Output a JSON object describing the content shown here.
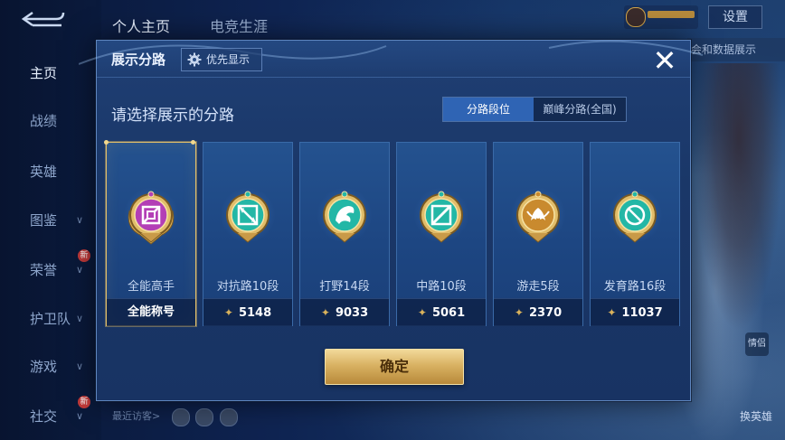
{
  "top_tabs": [
    {
      "label": "个人主页"
    },
    {
      "label": "电竞生涯"
    }
  ],
  "settings_label": "设置",
  "right_plate_text": "会和数据展示",
  "left_nav": [
    {
      "label": "主页",
      "chevron": false,
      "new": false
    },
    {
      "label": "战绩",
      "chevron": false,
      "new": false
    },
    {
      "label": "英雄",
      "chevron": false,
      "new": false
    },
    {
      "label": "图鉴",
      "chevron": true,
      "new": false
    },
    {
      "label": "荣誉",
      "chevron": true,
      "new": true
    },
    {
      "label": "护卫队",
      "chevron": true,
      "new": false
    },
    {
      "label": "游戏",
      "chevron": true,
      "new": false
    },
    {
      "label": "社交",
      "chevron": true,
      "new": true
    }
  ],
  "new_badge": "新",
  "recent_visit_label": "最近访客>",
  "change_hero_label": "换英雄",
  "change_hero_icon": "情侣",
  "dialog": {
    "title": "展示分路",
    "priority_button": "优先显示",
    "close_icon": "close-icon",
    "section_title": "请选择展示的分路",
    "tabs": [
      {
        "label": "分路段位",
        "active": true
      },
      {
        "label": "巅峰分路(全国)",
        "active": false
      }
    ],
    "cards": [
      {
        "name": "全能高手",
        "footer": "全能称号",
        "has_star": false,
        "selected": true,
        "emblem": "all-round-emblem-icon",
        "color": "#b33fb6"
      },
      {
        "name": "对抗路10段",
        "footer": "5148",
        "has_star": true,
        "selected": false,
        "emblem": "clash-lane-emblem-icon",
        "color": "#23b7a6"
      },
      {
        "name": "打野14段",
        "footer": "9033",
        "has_star": true,
        "selected": false,
        "emblem": "jungle-emblem-icon",
        "color": "#23b7a6"
      },
      {
        "name": "中路10段",
        "footer": "5061",
        "has_star": true,
        "selected": false,
        "emblem": "mid-lane-emblem-icon",
        "color": "#23b7a6"
      },
      {
        "name": "游走5段",
        "footer": "2370",
        "has_star": true,
        "selected": false,
        "emblem": "roam-emblem-icon",
        "color": "#c98a2e"
      },
      {
        "name": "发育路16段",
        "footer": "11037",
        "has_star": true,
        "selected": false,
        "emblem": "farm-lane-emblem-icon",
        "color": "#23b7a6"
      }
    ],
    "star_glyph": "✦",
    "confirm_label": "确定"
  }
}
